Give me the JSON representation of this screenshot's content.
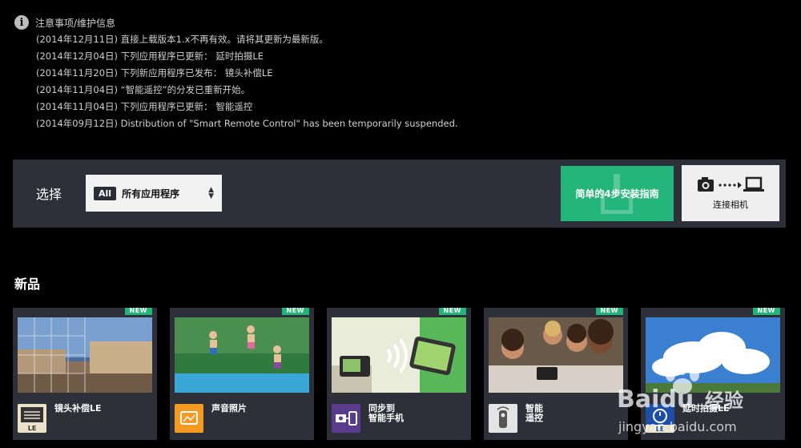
{
  "notice": {
    "title": "注意事项/维护信息",
    "items": [
      "(2014年12月11日) 直接上载版本1.x不再有效。请将其更新为最新版。",
      "(2014年12月04日) 下列应用程序已更新： 延时拍摄LE",
      "(2014年11月20日) 下列新应用程序已发布： 镜头补偿LE",
      "(2014年11月04日) “智能遥控”的分发已重新开始。",
      "(2014年11月04日) 下列应用程序已更新： 智能遥控",
      "(2014年09月12日) Distribution of \"Smart Remote Control\" has been temporarily suspended."
    ]
  },
  "filter": {
    "label": "选择",
    "badge": "All",
    "value": "所有应用程序",
    "guide_button": "简单的4步安装指南",
    "connect_button": "连接相机"
  },
  "section": {
    "title": "新品"
  },
  "apps": [
    {
      "badge": "NEW",
      "name": "镜头补偿LE",
      "icon": "lens-correction-icon",
      "icon_tag": "LE"
    },
    {
      "badge": "NEW",
      "name": "声音照片",
      "icon": "sound-photo-icon"
    },
    {
      "badge": "NEW",
      "name": "同步到\n智能手机",
      "icon": "sync-smartphone-icon"
    },
    {
      "badge": "NEW",
      "name": "智能\n遥控",
      "icon": "smart-remote-icon"
    },
    {
      "badge": "NEW",
      "name": "延时拍摄LE",
      "icon": "time-lapse-icon",
      "icon_tag": "LE"
    }
  ],
  "watermark": {
    "brand": "Baidu",
    "sub": "经验",
    "url": "jingyan.baidu.com"
  },
  "colors": {
    "accent": "#23b57a",
    "panel": "#2d3039",
    "background": "#000000"
  }
}
